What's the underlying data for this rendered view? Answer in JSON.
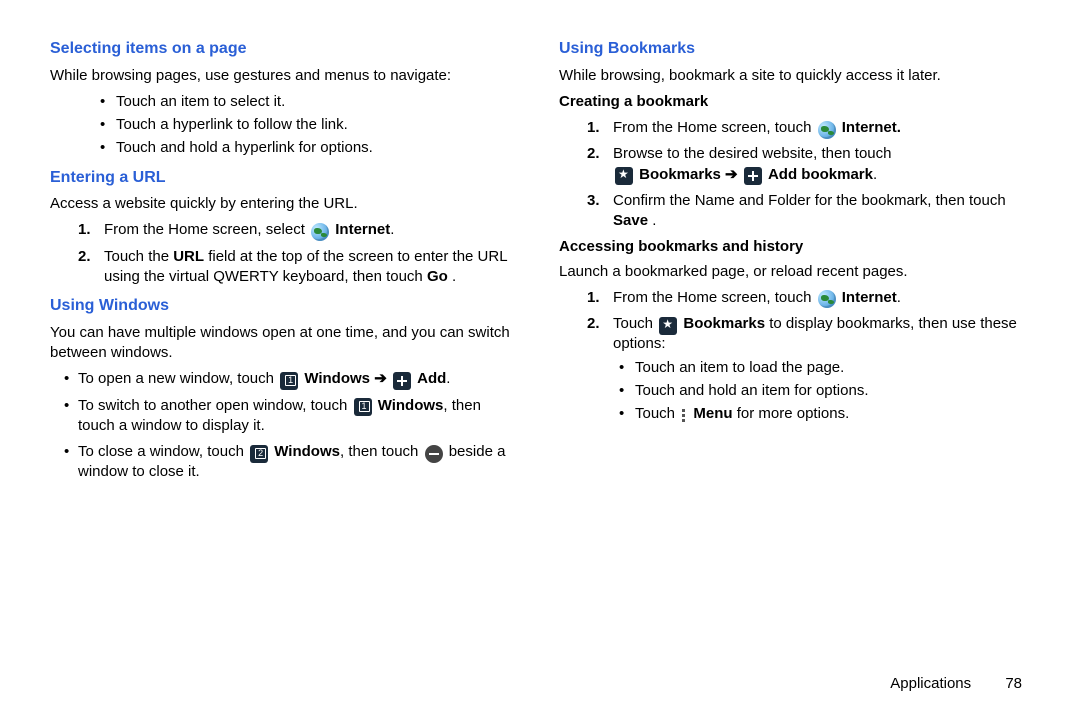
{
  "left": {
    "sel": {
      "h": "Selecting items on a page",
      "intro": "While browsing pages, use gestures and menus to navigate:",
      "b": [
        "Touch an item to select it.",
        "Touch a hyperlink to follow the link.",
        "Touch and hold a hyperlink for options."
      ]
    },
    "url": {
      "h": "Entering a URL",
      "intro": "Access a website quickly by entering the URL.",
      "s1a": "From the Home screen, select ",
      "s1b": "Internet",
      "s1c": ".",
      "s2a": "Touch the ",
      "s2b": "URL",
      "s2c": " field at the top of the screen to enter the URL using the virtual QWERTY keyboard, then touch ",
      "s2d": "Go",
      "s2e": "."
    },
    "win": {
      "h": "Using Windows",
      "intro": "You can have multiple windows open at one time, and you can switch between windows.",
      "b1a": "To open a new window, touch ",
      "b1b": "Windows",
      "b1c": "Add",
      "b1d": ".",
      "b2a": "To switch to another open window, touch ",
      "b2b": "Windows",
      "b2c": ", then touch a window to display it.",
      "b3a": "To close a window, touch ",
      "b3b": "Windows",
      "b3c": ", then touch ",
      "b3d": " beside a window to close it."
    }
  },
  "right": {
    "bk": {
      "h": "Using Bookmarks",
      "intro": "While browsing, bookmark a site to quickly access it later.",
      "create": {
        "h": "Creating a bookmark",
        "s1a": "From the Home screen, touch ",
        "s1b": "Internet.",
        "s2": "Browse to the desired website, then touch",
        "s2b": "Bookmarks",
        "s2c": "Add bookmark",
        "s2d": ".",
        "s3a": "Confirm the Name and Folder for the bookmark, then touch ",
        "s3b": "Save",
        "s3c": "."
      },
      "access": {
        "h": "Accessing bookmarks and history",
        "intro": "Launch a bookmarked page, or reload recent pages.",
        "s1a": "From the Home screen, touch ",
        "s1b": "Internet",
        "s1c": ".",
        "s2a": "Touch ",
        "s2b": "Bookmarks",
        "s2c": " to display bookmarks, then use these options:",
        "b": [
          "Touch an item to load the page.",
          "Touch and hold an item for options."
        ],
        "b3a": "Touch ",
        "b3b": "Menu",
        "b3c": " for more options."
      }
    }
  },
  "arrow": "➔",
  "footer": {
    "section": "Applications",
    "page": "78"
  }
}
